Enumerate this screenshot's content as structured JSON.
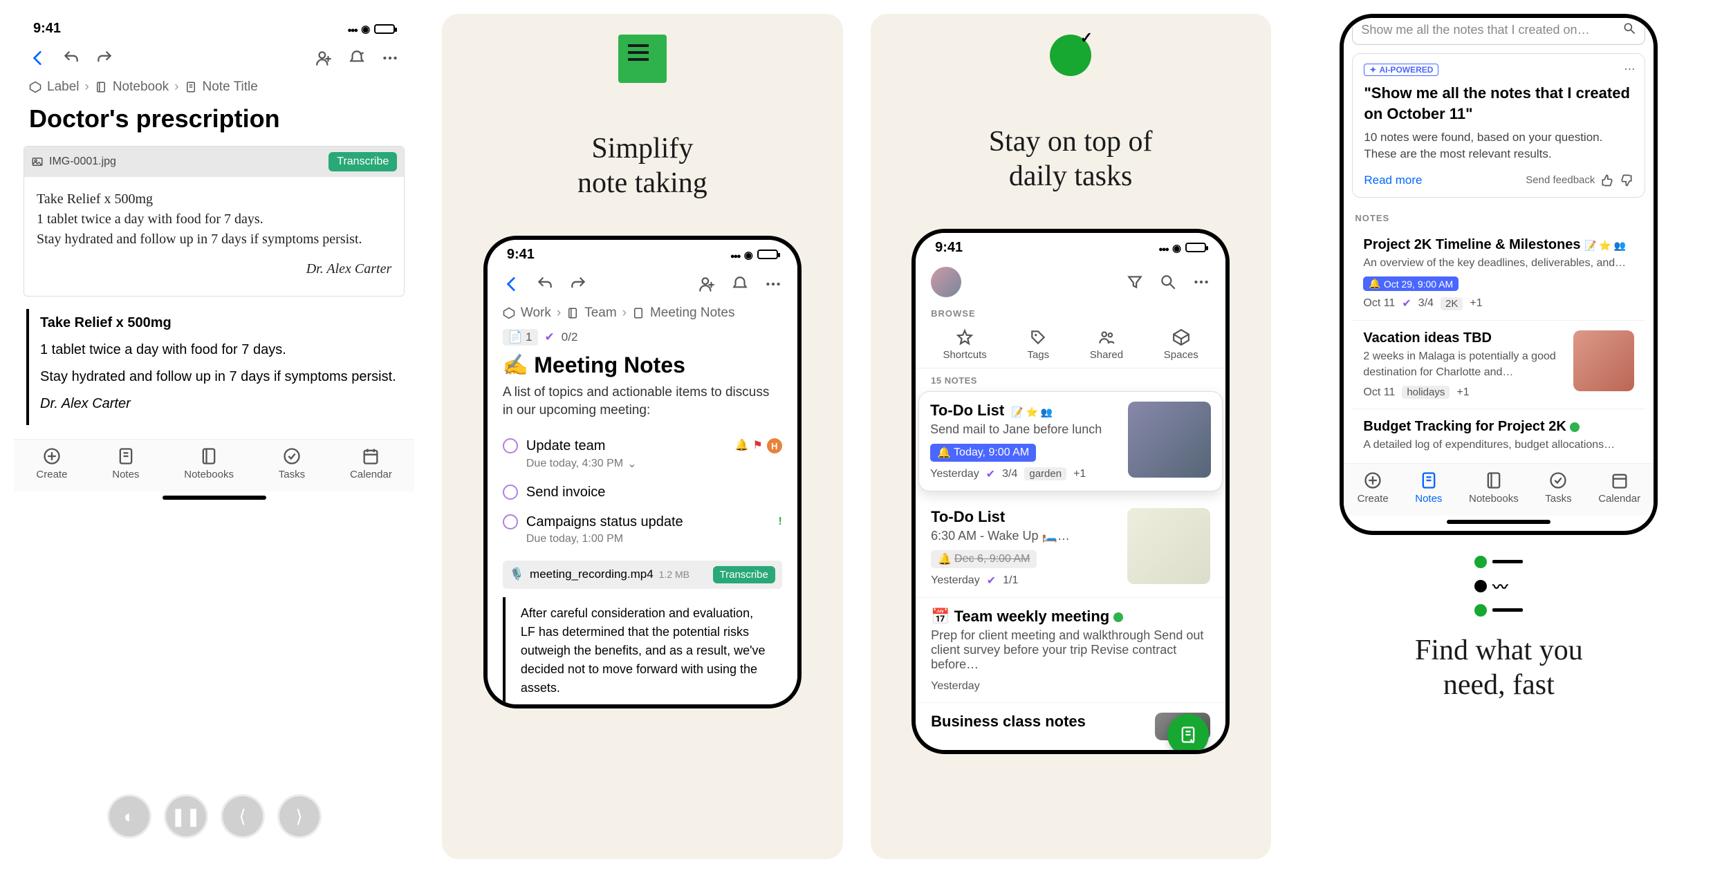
{
  "status_time": "9:41",
  "panel1": {
    "breadcrumb": [
      "Label",
      "Notebook",
      "Note Title"
    ],
    "title": "Doctor's prescription",
    "filename": "IMG-0001.jpg",
    "transcribe": "Transcribe",
    "h1": "Take Relief x 500mg",
    "h2": "1 tablet twice a day with food for 7 days.",
    "h3": "Stay hydrated and follow up in 7 days if symptoms persist.",
    "sig": "Dr. Alex Carter",
    "t1": "Take Relief x 500mg",
    "t2": "1 tablet twice a day with food for 7 days.",
    "t3": "Stay hydrated and follow up in 7 days if symptoms persist.",
    "t_author": "Dr. Alex Carter",
    "tabs": [
      "Create",
      "Notes",
      "Notebooks",
      "Tasks",
      "Calendar"
    ]
  },
  "panel2": {
    "headline1": "Simplify",
    "headline2": "note taking",
    "breadcrumb": [
      "Work",
      "Team",
      "Meeting Notes"
    ],
    "chip_note_glyph": "📄",
    "chip_note_count": "1",
    "chip_task_count": "0/2",
    "title": "Meeting Notes",
    "title_emoji": "✍️",
    "subtitle": "A list of topics and actionable items to discuss in our upcoming meeting:",
    "tasks": [
      {
        "label": "Update team",
        "meta": "Due today, 4:30 PM",
        "bell": true,
        "pin": true,
        "avatar": "H"
      },
      {
        "label": "Send invoice"
      },
      {
        "label": "Campaigns status update",
        "meta": "Due today, 1:00 PM",
        "excl": true
      }
    ],
    "file_name": "meeting_recording.mp4",
    "file_size": "1.2 MB",
    "paragraph": "After careful consideration and evaluation, LF has determined that the potential risks outweigh the benefits, and as a result, we've decided not to move forward with using the assets."
  },
  "panel3": {
    "headline1": "Stay on top of",
    "headline2": "daily tasks",
    "browse_label": "BROWSE",
    "tabs": [
      "Shortcuts",
      "Tags",
      "Shared",
      "Spaces"
    ],
    "notes_count": "15 NOTES",
    "featured": {
      "title": "To-Do List",
      "sub": "Send mail to Jane before lunch",
      "pill": "Today, 9:00 AM",
      "meta_date": "Yesterday",
      "meta_done": "3/4",
      "meta_tag": "garden",
      "meta_plus": "+1"
    },
    "cards": [
      {
        "title": "To-Do List",
        "sub": "6:30 AM - Wake Up 🛏️…",
        "pill": "Dec 6, 9:00 AM",
        "pill_strike": true,
        "meta_date": "Yesterday",
        "meta_done": "1/1"
      },
      {
        "title": "📅 Team weekly meeting",
        "people": true,
        "sub": "Prep for client meeting and walkthrough Send out client survey before your trip Revise contract before…",
        "meta_date": "Yesterday"
      },
      {
        "title": "Business class notes"
      }
    ]
  },
  "panel4": {
    "search_placeholder": "Show me all the notes that I created on…",
    "ai_badge": "AI-POWERED",
    "ai_title": "\"Show me all the notes that I created on October 11\"",
    "ai_body": "10 notes were found, based on your question. These are the most relevant results.",
    "read_more": "Read more",
    "send_feedback": "Send feedback",
    "notes_header": "NOTES",
    "results": [
      {
        "title": "Project 2K Timeline & Milestones",
        "sub": "An overview of the key deadlines, deliverables, and…",
        "pill": "Oct 29, 9:00 AM",
        "date": "Oct 11",
        "done": "3/4",
        "tag": "2K",
        "plus": "+1",
        "icons": "📝 ⭐ 👥"
      },
      {
        "title": "Vacation ideas TBD",
        "sub": "2 weeks in Malaga is potentially a good destination for Charlotte and…",
        "date": "Oct 11",
        "tag": "holidays",
        "plus": "+1",
        "thumb": true
      },
      {
        "title": "Budget Tracking for Project 2K",
        "sub": "A detailed log of expenditures, budget allocations…",
        "people": true
      }
    ],
    "tabs": [
      "Create",
      "Notes",
      "Notebooks",
      "Tasks",
      "Calendar"
    ],
    "headline1": "Find what you",
    "headline2": "need, fast"
  }
}
